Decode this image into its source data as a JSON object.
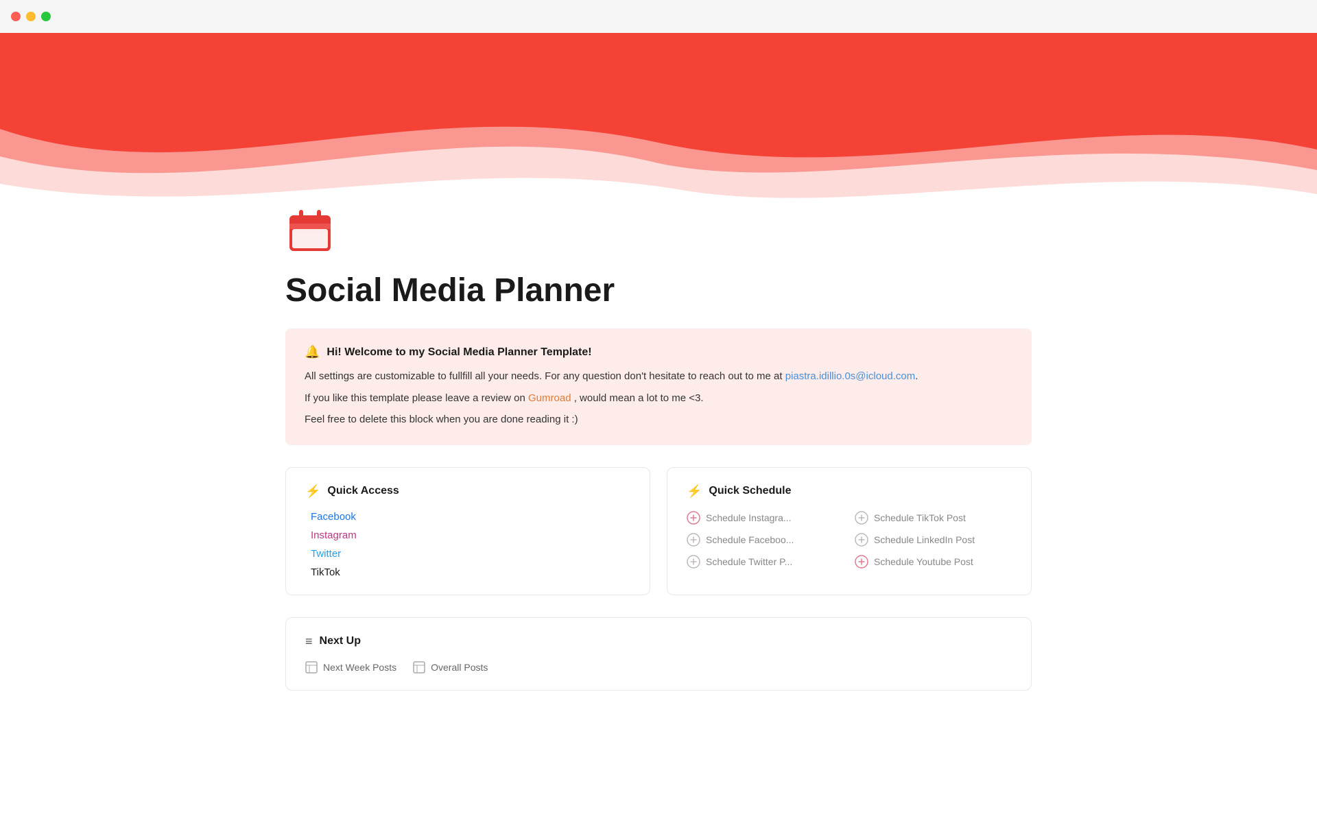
{
  "titlebar": {
    "buttons": [
      "close",
      "minimize",
      "maximize"
    ]
  },
  "hero": {
    "background_color": "#f44336"
  },
  "page": {
    "icon_label": "calendar-icon",
    "title": "Social Media Planner"
  },
  "welcome": {
    "icon": "🔔",
    "heading": "Hi! Welcome to my Social Media Planner Template!",
    "line1": "All settings are customizable to fullfill all your needs. For any question don't hesitate to reach out to me at",
    "email": "piastra.idillio.0s@icloud.com",
    "line2_prefix": "If you like this template please leave a review on",
    "gumroad_link": "Gumroad",
    "line2_suffix": ", would mean a lot to me <3.",
    "line3": "Feel free to delete this block when you are done reading it :)"
  },
  "quick_access": {
    "header_icon": "⚡",
    "title": "Quick Access",
    "links": [
      {
        "label": "Facebook",
        "color_class": "qa-facebook"
      },
      {
        "label": "Instagram",
        "color_class": "qa-instagram"
      },
      {
        "label": "Twitter",
        "color_class": "qa-twitter"
      },
      {
        "label": "TikTok",
        "color_class": "qa-tiktok"
      }
    ]
  },
  "quick_schedule": {
    "header_icon": "⚡",
    "title": "Quick Schedule",
    "items": [
      {
        "label": "Schedule Instagra..."
      },
      {
        "label": "Schedule TikTok Post"
      },
      {
        "label": "Schedule Faceboo..."
      },
      {
        "label": "Schedule LinkedIn Post"
      },
      {
        "label": "Schedule Twitter P..."
      },
      {
        "label": "Schedule Youtube Post"
      }
    ]
  },
  "next_up": {
    "header_icon": "≡",
    "title": "Next Up",
    "items": [
      {
        "label": "Next Week Posts"
      },
      {
        "label": "Overall Posts"
      }
    ]
  }
}
